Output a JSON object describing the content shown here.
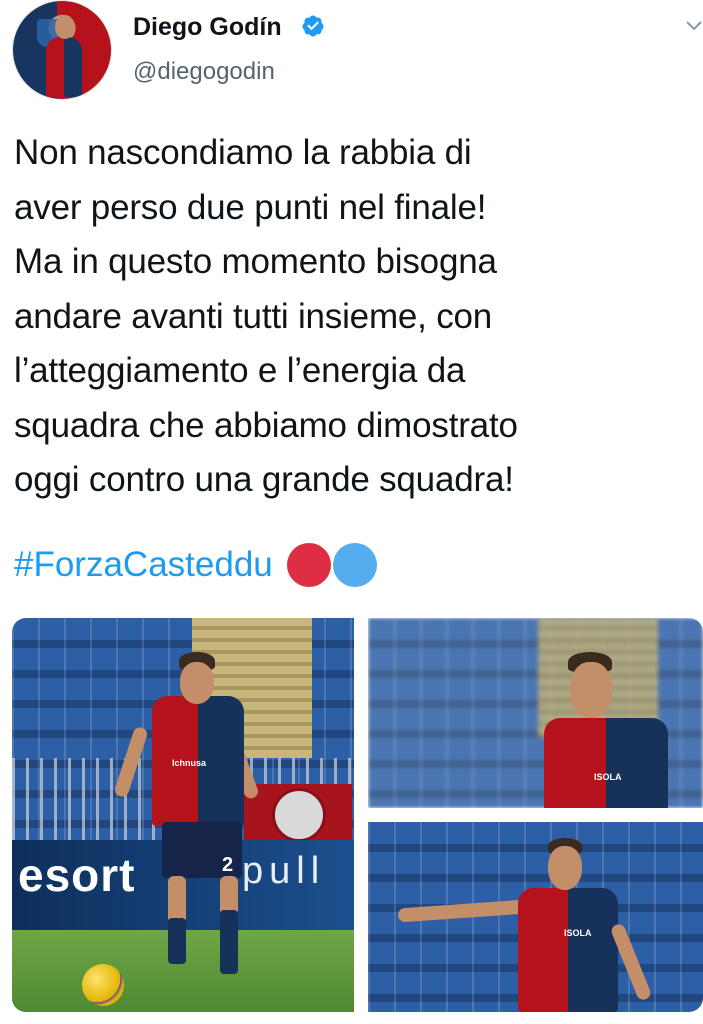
{
  "user": {
    "display_name": "Diego Godín",
    "handle": "@diegogodin",
    "verified": true,
    "avatar_icon": "profile-photo"
  },
  "tweet": {
    "text": "Non nascondiamo la rabbia di\naver perso due punti nel finale!\nMa in questo momento bisogna\nandare avanti tutti insieme, con\nl’atteggiamento e l’energia da\nsquadra che abbiamo dimostrato\noggi contro una grande squadra!",
    "hashtag": "#ForzaCasteddu",
    "emoji": [
      "red-circle",
      "blue-circle"
    ]
  },
  "media": {
    "photos": [
      {
        "id": "left",
        "description_icon": "player-dribbling-photo",
        "ad_text": "esort",
        "ad_text_2": "pull",
        "sponsor": "Ichnusa",
        "number": "2"
      },
      {
        "id": "top-right",
        "description_icon": "player-portrait-photo",
        "sponsor": "ISOLA"
      },
      {
        "id": "bottom-right",
        "description_icon": "player-pointing-photo",
        "sponsor": "ISOLA"
      }
    ]
  },
  "colors": {
    "link": "#1d9bf0",
    "verified": "#1d9bf0",
    "handle": "#536471",
    "text": "#0f1419",
    "emoji_red": "#dd2e44",
    "emoji_blue": "#55acee"
  }
}
